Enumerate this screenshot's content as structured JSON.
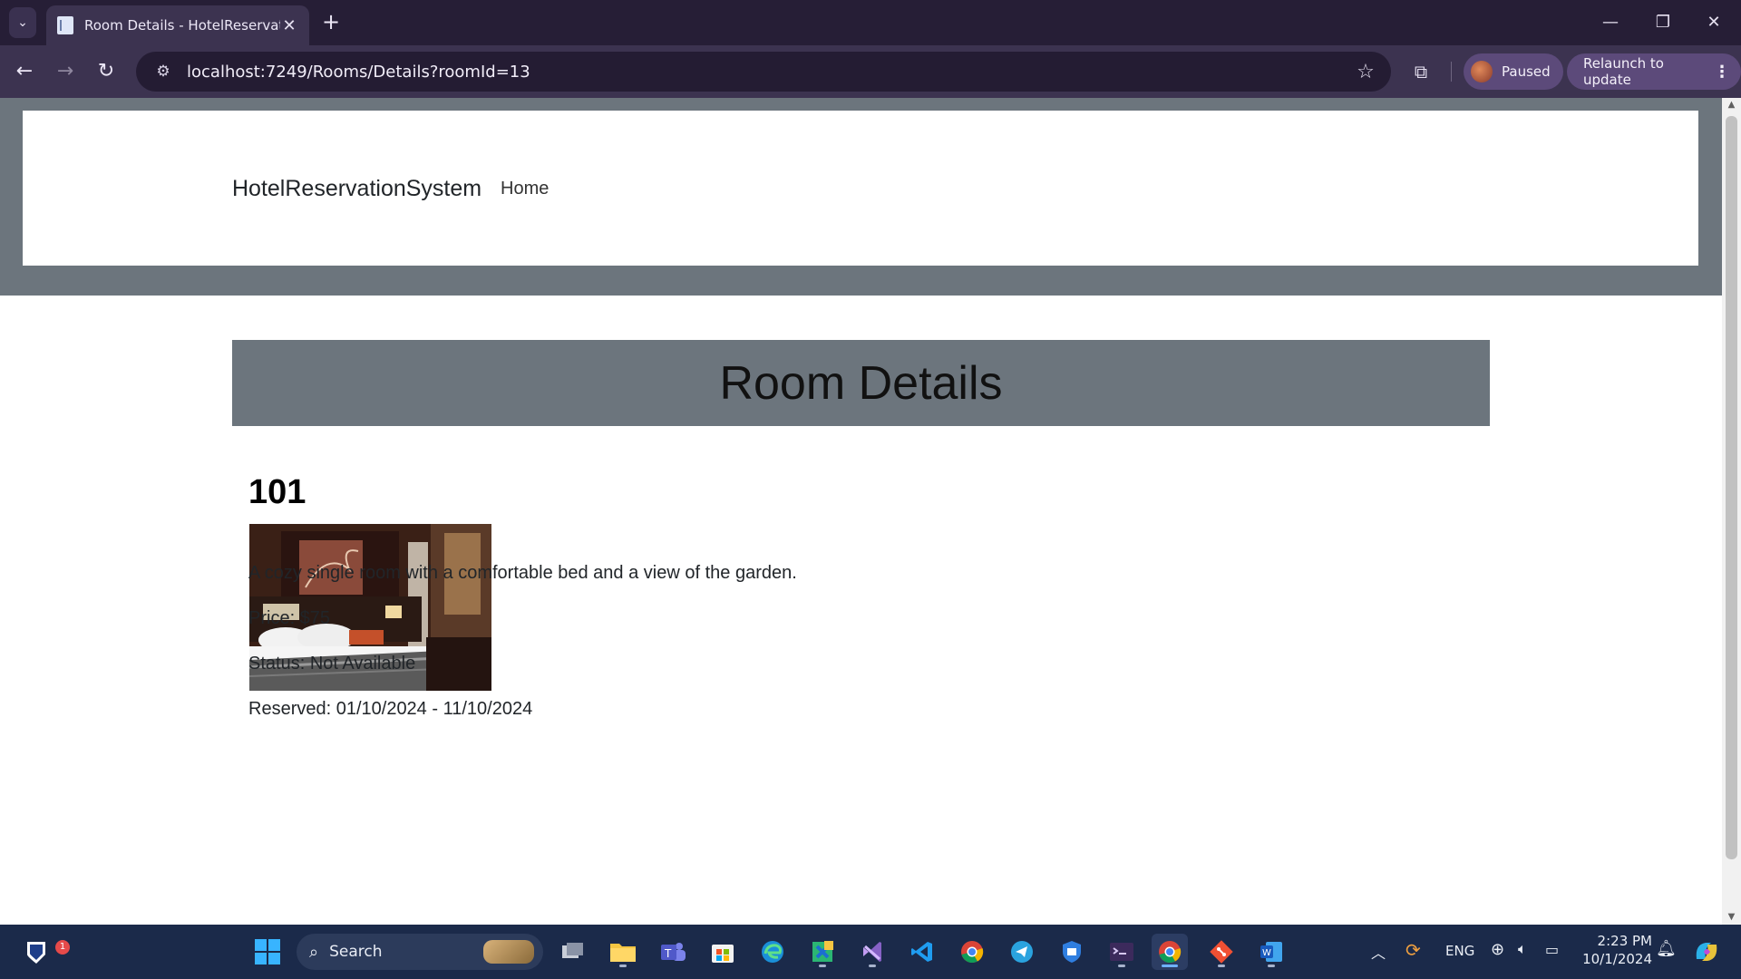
{
  "browser": {
    "tab_title": "Room Details - HotelReservationSystem",
    "url": "localhost:7249/Rooms/Details?roomId=13",
    "profile_label": "Paused",
    "relaunch_label": "Relaunch to update",
    "tab_close_glyph": "✕",
    "new_tab_glyph": "+",
    "window_controls": {
      "minimize": "—",
      "restore": "❐",
      "close": "✕"
    },
    "nav": {
      "back": "←",
      "forward": "→",
      "reload": "↻"
    },
    "star_glyph": "☆"
  },
  "site": {
    "brand": "HotelReservationSystem",
    "nav_home": "Home"
  },
  "page": {
    "title": "Room Details",
    "room": {
      "number": "101",
      "image_alt": "Hotel room with bed",
      "description": "A cozy single room with a comfortable bed and a view of the garden.",
      "price": "Price: $75",
      "status": "Status: Not Available",
      "reserved": "Reserved: 01/10/2024 - 11/10/2024"
    }
  },
  "taskbar": {
    "search_label": "Search",
    "notification_count": "1",
    "tray": {
      "language": "ENG",
      "time": "2:23 PM",
      "date": "10/1/2024"
    },
    "apps": [
      "file-explorer-icon",
      "teams-icon",
      "store-icon",
      "edge-icon",
      "vs-code-insiders-icon",
      "visual-studio-icon",
      "vscode-icon",
      "chrome-icon",
      "telegram-icon",
      "defender-icon",
      "terminal-icon",
      "chrome-active-icon",
      "git-icon",
      "word-icon"
    ]
  },
  "colors": {
    "header_band": "#6c757d",
    "title_bar": "#6c757d",
    "browser_frame": "#261e36",
    "toolbar": "#3c3350",
    "taskbar": "#1b2a4a"
  }
}
